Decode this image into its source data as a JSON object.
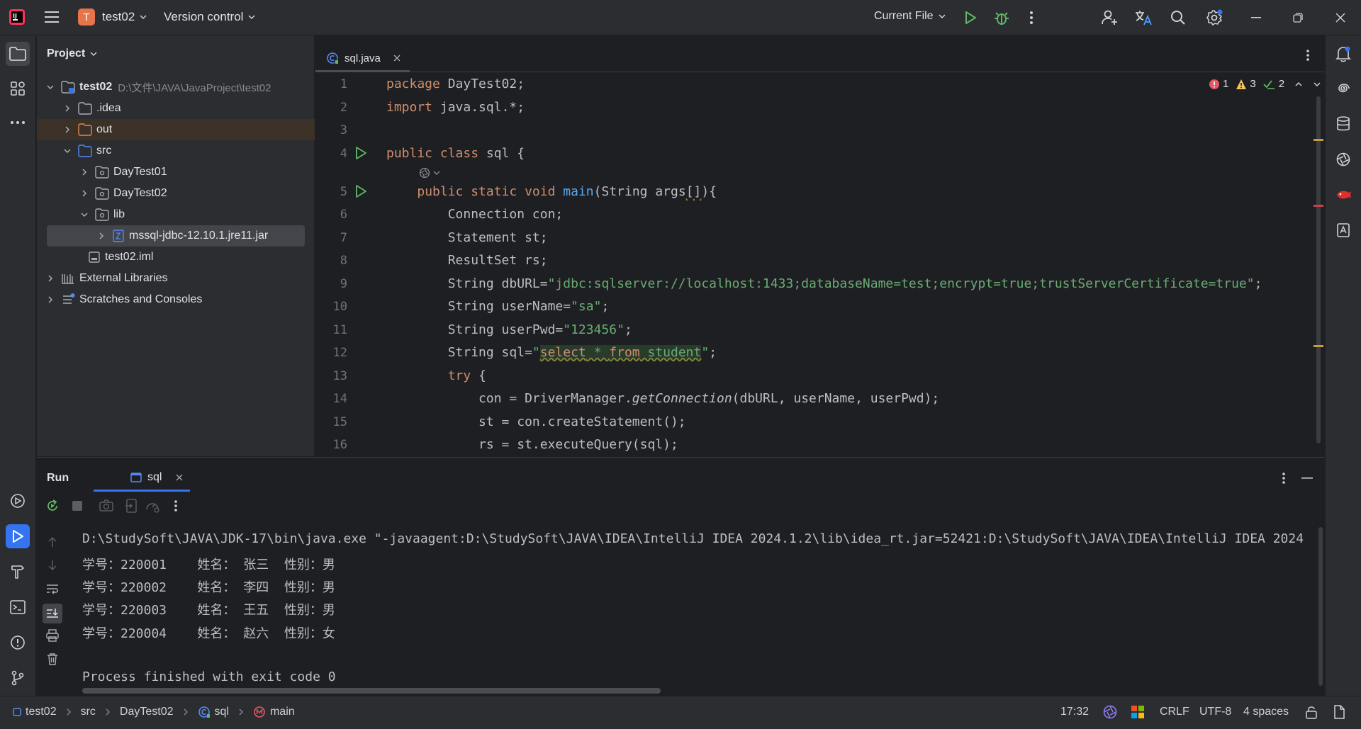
{
  "titlebar": {
    "project_initial": "T",
    "project_name": "test02",
    "vcs_label": "Version control",
    "run_config": "Current File"
  },
  "project_panel": {
    "title": "Project",
    "tree": [
      {
        "label": "test02",
        "path": "D:\\文件\\JAVA\\JavaProject\\test02",
        "icon": "module-folder-icon",
        "level": 0,
        "expanded": true,
        "bold": true
      },
      {
        "label": ".idea",
        "icon": "folder-icon",
        "level": 1,
        "expanded": false
      },
      {
        "label": "out",
        "icon": "excluded-folder-icon",
        "level": 1,
        "expanded": false,
        "highlight": true
      },
      {
        "label": "src",
        "icon": "source-folder-icon",
        "level": 1,
        "expanded": true
      },
      {
        "label": "DayTest01",
        "icon": "package-icon",
        "level": 2,
        "expanded": false
      },
      {
        "label": "DayTest02",
        "icon": "package-icon",
        "level": 2,
        "expanded": false
      },
      {
        "label": "lib",
        "icon": "package-icon",
        "level": 2,
        "expanded": true
      },
      {
        "label": "mssql-jdbc-12.10.1.jre11.jar",
        "icon": "jar-icon",
        "level": 3,
        "expanded": false,
        "selected": true
      },
      {
        "label": "test02.iml",
        "icon": "iml-file-icon",
        "level": 1
      },
      {
        "label": "External Libraries",
        "icon": "library-icon",
        "level": 0,
        "expanded": false
      },
      {
        "label": "Scratches and Consoles",
        "icon": "scratches-icon",
        "level": 0,
        "expanded": false
      }
    ]
  },
  "editor": {
    "tab_label": "sql.java",
    "inspections": {
      "errors": "1",
      "warnings": "3",
      "weak": "2"
    },
    "line_numbers": [
      "1",
      "2",
      "3",
      "4",
      "5",
      "6",
      "7",
      "8",
      "9",
      "10",
      "11",
      "12",
      "13",
      "14",
      "15",
      "16"
    ]
  },
  "run_panel": {
    "title": "Run",
    "tab_label": "sql",
    "output": [
      "D:\\StudySoft\\JAVA\\JDK-17\\bin\\java.exe \"-javaagent:D:\\StudySoft\\JAVA\\IDEA\\IntelliJ IDEA 2024.1.2\\lib\\idea_rt.jar=52421:D:\\StudySoft\\JAVA\\IDEA\\IntelliJ IDEA 2024",
      "学号：220001    姓名： 张三  性别：男",
      "学号：220002    姓名： 李四  性别：男",
      "学号：220003    姓名： 王五  性别：男",
      "学号：220004    姓名： 赵六  性别：女",
      "",
      "Process finished with exit code 0"
    ]
  },
  "statusbar": {
    "breadcrumbs": [
      "test02",
      "src",
      "DayTest02",
      "sql",
      "main"
    ],
    "position": "17:32",
    "line_ending": "CRLF",
    "encoding": "UTF-8",
    "indent": "4 spaces"
  },
  "colors": {
    "accent": "#3574f0",
    "keyword": "#cf8e6d",
    "string": "#6aab73",
    "function": "#56a8f5"
  }
}
